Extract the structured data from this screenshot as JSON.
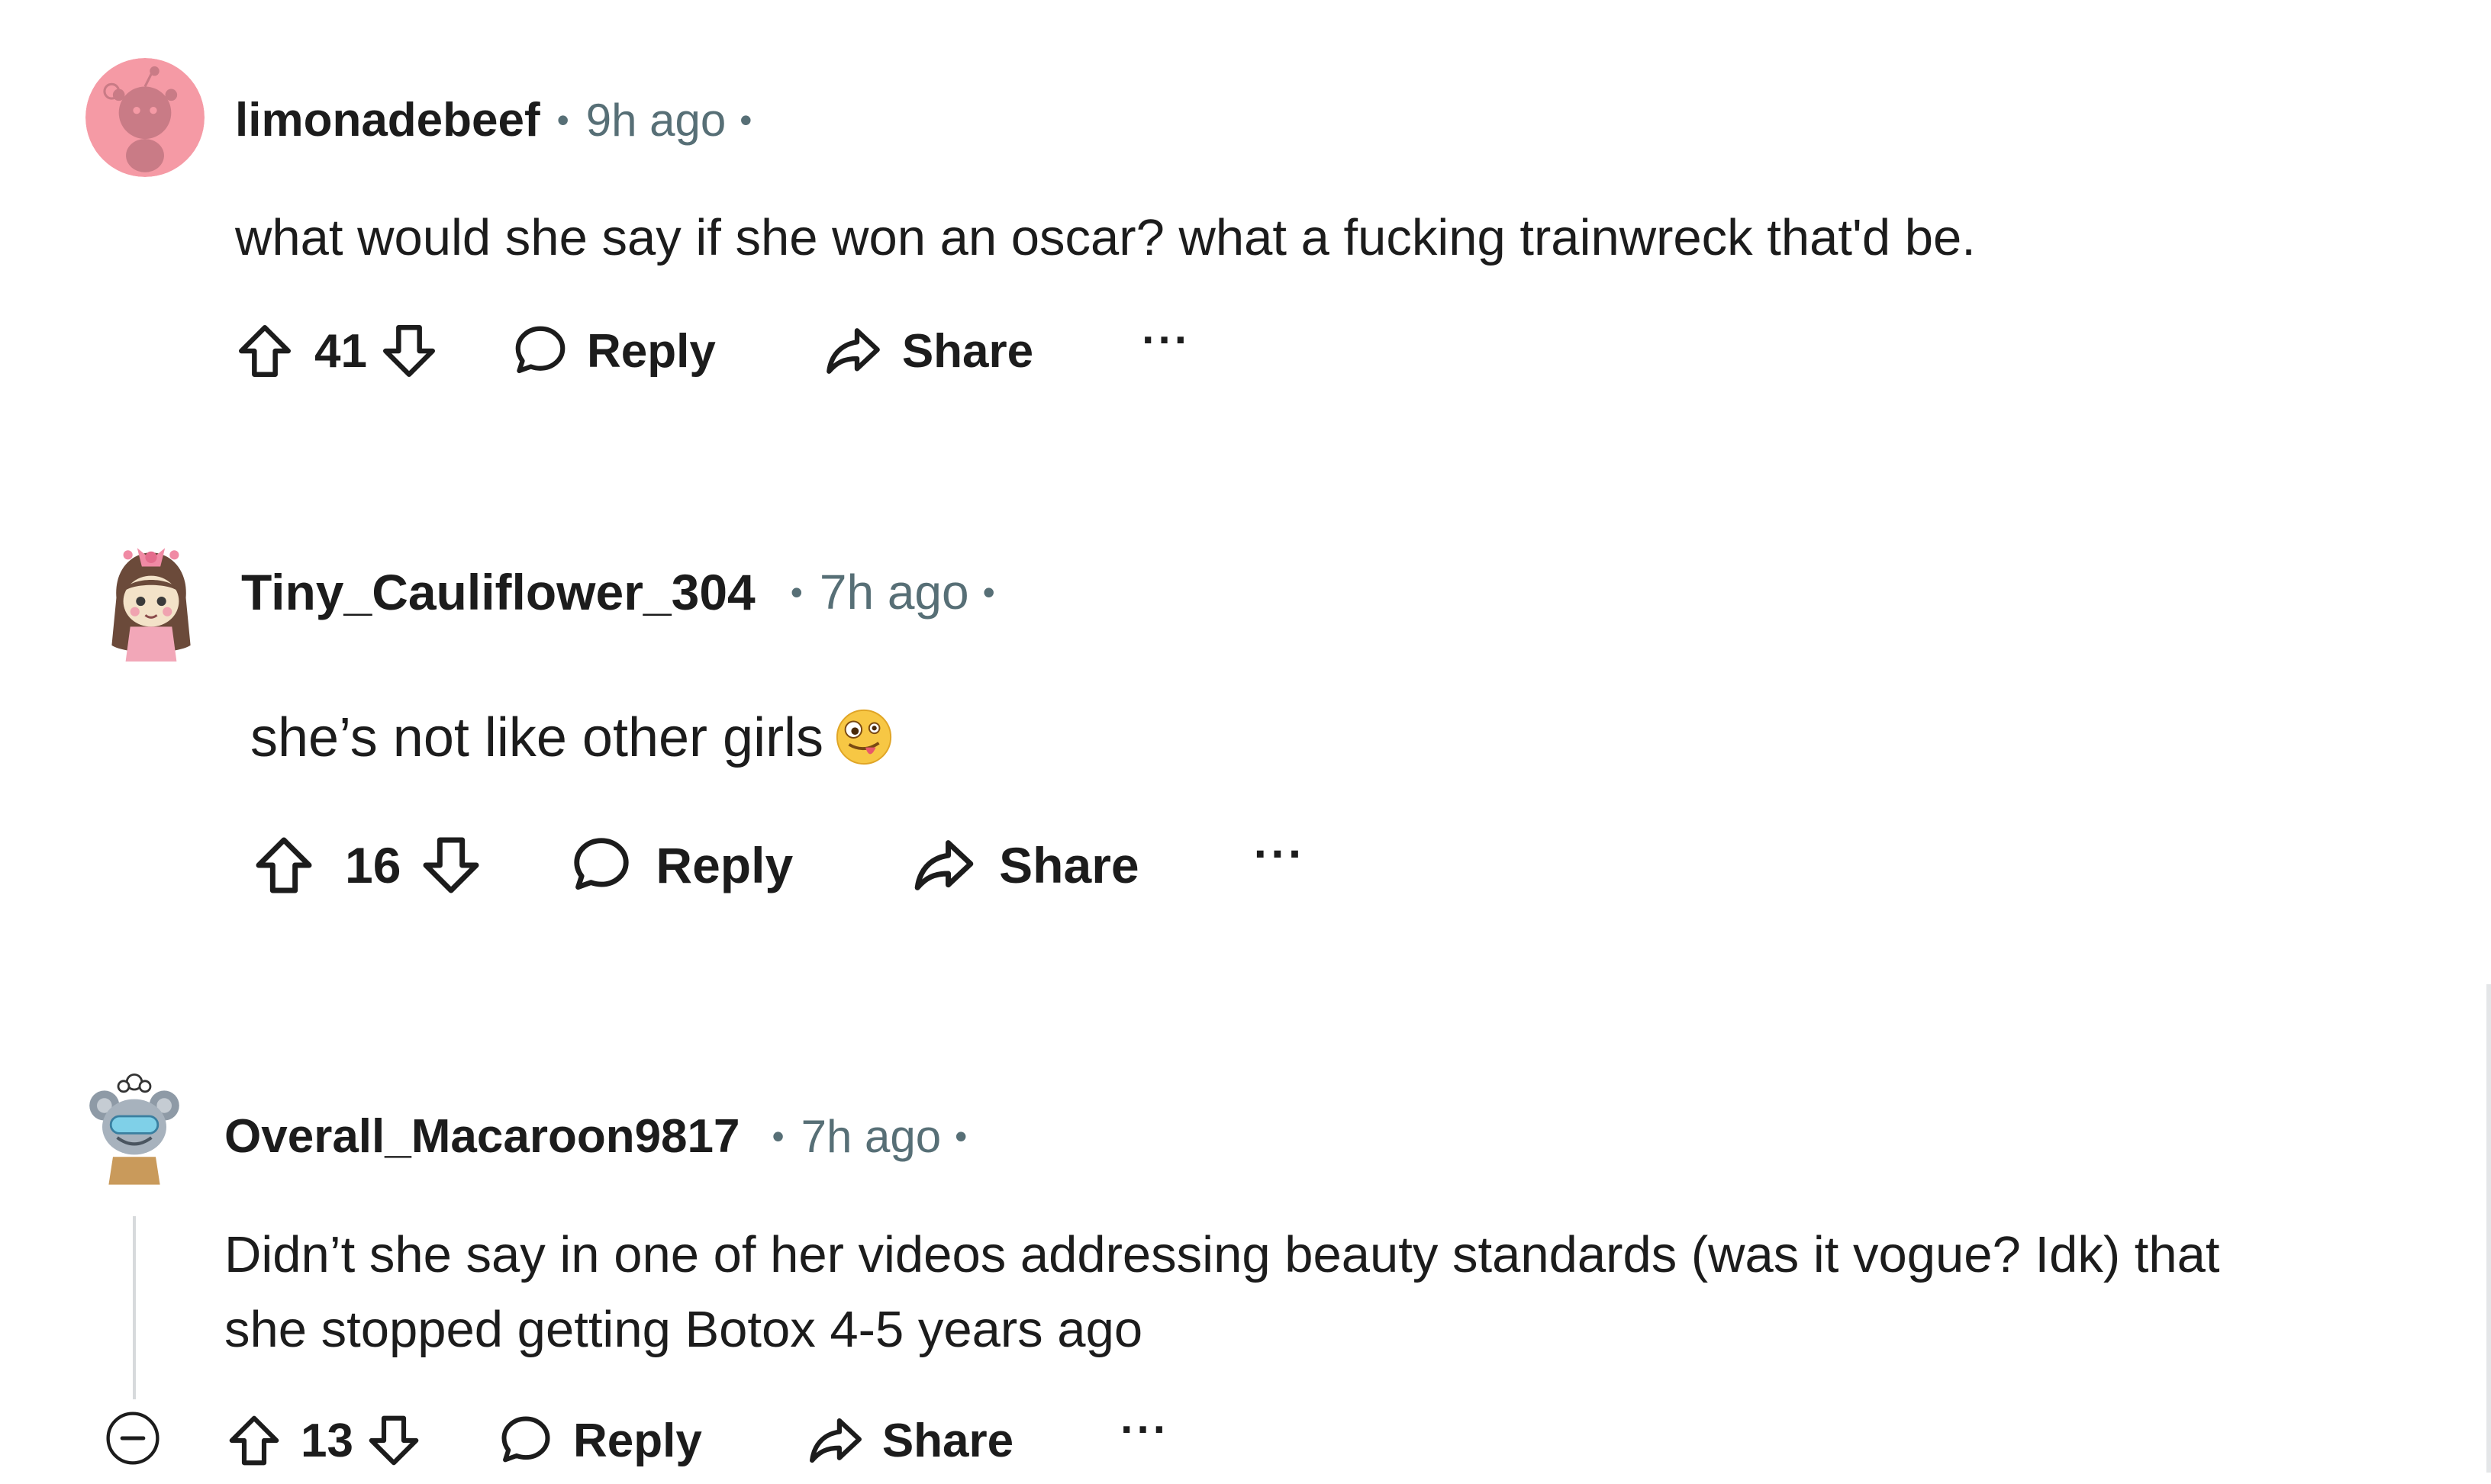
{
  "comments": [
    {
      "username": "limonadebeef",
      "time": "9h ago",
      "separator": "•",
      "text": "what would she say if she won an oscar? what a fucking trainwreck that'd be.",
      "score": "41",
      "reply_label": "Reply",
      "share_label": "Share",
      "more_label": "···"
    },
    {
      "username": "Tiny_Cauliflower_304",
      "time": "7h ago",
      "separator": "•",
      "text": "she’s not like other girls",
      "emoji": "zany-face",
      "score": "16",
      "reply_label": "Reply",
      "share_label": "Share",
      "more_label": "···"
    },
    {
      "username": "Overall_Macaroon9817",
      "time": "7h ago",
      "separator": "•",
      "text_line1": "Didn’t she say in one of her videos addressing beauty standards (was it vogue? Idk) that",
      "text_line2": "she stopped getting Botox 4-5 years ago",
      "score": "13",
      "reply_label": "Reply",
      "share_label": "Share",
      "more_label": "···"
    }
  ],
  "colors": {
    "text": "#1c1c1c",
    "meta": "#576f76",
    "avatar_pink": "#f59aa5",
    "thread_line": "#d7dadc"
  }
}
